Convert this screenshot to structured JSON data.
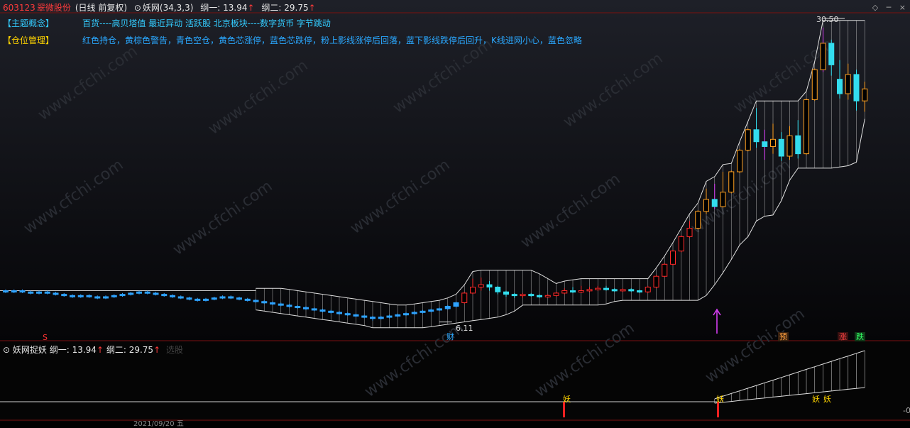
{
  "header": {
    "code": "603123",
    "name": "翠微股份",
    "mode": "(日线 前复权)",
    "indicator": "妖网(34,3,3)",
    "line1_label": "纲一: 13.94",
    "line2_label": "纲二: 29.75",
    "up_arrow": "↑"
  },
  "window_controls": {
    "diamond": "◇",
    "minimize": "─",
    "close": "×"
  },
  "concepts": {
    "theme_label": "【主题概念】",
    "theme_text": "百货----高贝塔值 最近异动 活跃股 北京板块----数字货币 字节跳动",
    "position_label": "【仓位管理】",
    "position_text": "红色持仓，黄棕色警告，青色空仓，黄色芯涨停，蓝色芯跌停，粉上影线涨停后回落，蓝下影线跌停后回升，K线进网小心，蓝色忽略"
  },
  "price_labels": {
    "high": "30.50",
    "low": "6.11"
  },
  "markers": {
    "s": "S",
    "cai": "财",
    "yu": "预",
    "zhang": "涨",
    "die": "跌"
  },
  "sub_panel": {
    "title": "妖网捉妖",
    "line1_label": "纲一: 13.94",
    "line2_label": "纲二: 29.75",
    "up_arrow": "↑",
    "extra": "选股",
    "yao_marks": [
      "妖",
      "妖",
      "妖",
      "妖"
    ]
  },
  "footer": {
    "date_fragment": "2021/09/20 五",
    "right_zero": "-0"
  },
  "watermark": "www.cfchi.com",
  "colors": {
    "up": "#ff2a2a",
    "down": "#2ea3ff",
    "cyan": "#33ddee",
    "yellow": "#ffd400",
    "magenta": "#e040ff",
    "orange": "#ffa020"
  },
  "chart_data": {
    "type": "candlestick",
    "ylim": [
      5.5,
      31.5
    ],
    "candles": [
      {
        "o": 8.6,
        "c": 8.5,
        "h": 8.7,
        "l": 8.4
      },
      {
        "o": 8.5,
        "c": 8.6,
        "h": 8.7,
        "l": 8.4
      },
      {
        "o": 8.6,
        "c": 8.5,
        "h": 8.7,
        "l": 8.4
      },
      {
        "o": 8.5,
        "c": 8.4,
        "h": 8.6,
        "l": 8.3
      },
      {
        "o": 8.4,
        "c": 8.5,
        "h": 8.6,
        "l": 8.3
      },
      {
        "o": 8.5,
        "c": 8.4,
        "h": 8.6,
        "l": 8.3
      },
      {
        "o": 8.4,
        "c": 8.3,
        "h": 8.5,
        "l": 8.2
      },
      {
        "o": 8.3,
        "c": 8.2,
        "h": 8.4,
        "l": 8.1
      },
      {
        "o": 8.2,
        "c": 8.1,
        "h": 8.3,
        "l": 8.0
      },
      {
        "o": 8.1,
        "c": 8.2,
        "h": 8.3,
        "l": 8.0
      },
      {
        "o": 8.2,
        "c": 8.1,
        "h": 8.3,
        "l": 8.0
      },
      {
        "o": 8.1,
        "c": 8.0,
        "h": 8.2,
        "l": 7.9
      },
      {
        "o": 8.0,
        "c": 8.1,
        "h": 8.2,
        "l": 7.9
      },
      {
        "o": 8.1,
        "c": 8.2,
        "h": 8.3,
        "l": 8.0
      },
      {
        "o": 8.2,
        "c": 8.3,
        "h": 8.4,
        "l": 8.1
      },
      {
        "o": 8.3,
        "c": 8.4,
        "h": 8.5,
        "l": 8.2
      },
      {
        "o": 8.4,
        "c": 8.5,
        "h": 8.6,
        "l": 8.3
      },
      {
        "o": 8.5,
        "c": 8.4,
        "h": 8.6,
        "l": 8.3
      },
      {
        "o": 8.4,
        "c": 8.3,
        "h": 8.5,
        "l": 8.2
      },
      {
        "o": 8.3,
        "c": 8.2,
        "h": 8.4,
        "l": 8.1
      },
      {
        "o": 8.2,
        "c": 8.1,
        "h": 8.3,
        "l": 8.0
      },
      {
        "o": 8.1,
        "c": 8.0,
        "h": 8.2,
        "l": 7.9
      },
      {
        "o": 8.0,
        "c": 7.9,
        "h": 8.1,
        "l": 7.8
      },
      {
        "o": 7.9,
        "c": 7.8,
        "h": 8.0,
        "l": 7.7
      },
      {
        "o": 7.8,
        "c": 7.9,
        "h": 8.0,
        "l": 7.7
      },
      {
        "o": 7.9,
        "c": 8.0,
        "h": 8.1,
        "l": 7.8
      },
      {
        "o": 8.0,
        "c": 8.1,
        "h": 8.2,
        "l": 7.9
      },
      {
        "o": 8.1,
        "c": 8.0,
        "h": 8.2,
        "l": 7.9
      },
      {
        "o": 8.0,
        "c": 7.9,
        "h": 8.1,
        "l": 7.8
      },
      {
        "o": 7.9,
        "c": 7.8,
        "h": 8.0,
        "l": 7.7
      },
      {
        "o": 7.8,
        "c": 7.7,
        "h": 7.9,
        "l": 7.6
      },
      {
        "o": 7.7,
        "c": 7.6,
        "h": 7.8,
        "l": 7.5
      },
      {
        "o": 7.6,
        "c": 7.5,
        "h": 7.7,
        "l": 7.4
      },
      {
        "o": 7.5,
        "c": 7.4,
        "h": 7.6,
        "l": 7.3
      },
      {
        "o": 7.4,
        "c": 7.3,
        "h": 7.5,
        "l": 7.2
      },
      {
        "o": 7.3,
        "c": 7.2,
        "h": 7.4,
        "l": 7.1
      },
      {
        "o": 7.2,
        "c": 7.1,
        "h": 7.3,
        "l": 7.0
      },
      {
        "o": 7.1,
        "c": 7.0,
        "h": 7.2,
        "l": 6.9
      },
      {
        "o": 7.0,
        "c": 6.9,
        "h": 7.1,
        "l": 6.8
      },
      {
        "o": 6.9,
        "c": 6.8,
        "h": 7.0,
        "l": 6.7
      },
      {
        "o": 6.8,
        "c": 6.7,
        "h": 6.9,
        "l": 6.6
      },
      {
        "o": 6.7,
        "c": 6.6,
        "h": 6.8,
        "l": 6.5
      },
      {
        "o": 6.6,
        "c": 6.5,
        "h": 6.7,
        "l": 6.4
      },
      {
        "o": 6.5,
        "c": 6.4,
        "h": 6.6,
        "l": 6.3
      },
      {
        "o": 6.4,
        "c": 6.3,
        "h": 6.5,
        "l": 6.11
      },
      {
        "o": 6.3,
        "c": 6.4,
        "h": 6.5,
        "l": 6.2
      },
      {
        "o": 6.4,
        "c": 6.5,
        "h": 6.6,
        "l": 6.3
      },
      {
        "o": 6.5,
        "c": 6.6,
        "h": 6.7,
        "l": 6.4
      },
      {
        "o": 6.6,
        "c": 6.7,
        "h": 6.8,
        "l": 6.5
      },
      {
        "o": 6.7,
        "c": 6.8,
        "h": 6.9,
        "l": 6.6
      },
      {
        "o": 6.8,
        "c": 6.9,
        "h": 7.0,
        "l": 6.7
      },
      {
        "o": 6.9,
        "c": 7.0,
        "h": 7.1,
        "l": 6.8
      },
      {
        "o": 7.0,
        "c": 7.1,
        "h": 7.2,
        "l": 6.9
      },
      {
        "o": 7.1,
        "c": 7.3,
        "h": 7.4,
        "l": 7.0
      },
      {
        "o": 7.3,
        "c": 7.6,
        "h": 7.7,
        "l": 7.2
      },
      {
        "o": 7.6,
        "c": 8.4,
        "h": 8.5,
        "l": 7.5
      },
      {
        "o": 8.4,
        "c": 8.9,
        "h": 9.6,
        "l": 8.3
      },
      {
        "o": 8.9,
        "c": 9.1,
        "h": 9.7,
        "l": 8.6
      },
      {
        "o": 9.1,
        "c": 8.9,
        "h": 9.4,
        "l": 8.6
      },
      {
        "o": 8.9,
        "c": 8.5,
        "h": 9.0,
        "l": 8.3
      },
      {
        "o": 8.5,
        "c": 8.3,
        "h": 8.6,
        "l": 8.1
      },
      {
        "o": 8.3,
        "c": 8.2,
        "h": 8.4,
        "l": 8.0
      },
      {
        "o": 8.2,
        "c": 8.3,
        "h": 8.4,
        "l": 8.0
      },
      {
        "o": 8.3,
        "c": 8.2,
        "h": 8.4,
        "l": 8.1
      },
      {
        "o": 8.2,
        "c": 8.1,
        "h": 8.3,
        "l": 8.0
      },
      {
        "o": 8.1,
        "c": 8.2,
        "h": 8.3,
        "l": 8.0
      },
      {
        "o": 8.2,
        "c": 8.4,
        "h": 8.5,
        "l": 8.1
      },
      {
        "o": 8.4,
        "c": 8.6,
        "h": 8.8,
        "l": 8.3
      },
      {
        "o": 8.6,
        "c": 8.5,
        "h": 8.9,
        "l": 8.4
      },
      {
        "o": 8.5,
        "c": 8.6,
        "h": 9.0,
        "l": 8.4
      },
      {
        "o": 8.6,
        "c": 8.7,
        "h": 8.9,
        "l": 8.5
      },
      {
        "o": 8.7,
        "c": 8.8,
        "h": 9.0,
        "l": 8.6
      },
      {
        "o": 8.8,
        "c": 8.7,
        "h": 9.0,
        "l": 8.6
      },
      {
        "o": 8.7,
        "c": 8.6,
        "h": 8.8,
        "l": 8.5
      },
      {
        "o": 8.6,
        "c": 8.7,
        "h": 8.8,
        "l": 8.5
      },
      {
        "o": 8.7,
        "c": 8.6,
        "h": 8.8,
        "l": 8.5
      },
      {
        "o": 8.6,
        "c": 8.5,
        "h": 8.7,
        "l": 8.4
      },
      {
        "o": 8.5,
        "c": 8.9,
        "h": 9.0,
        "l": 8.4
      },
      {
        "o": 8.9,
        "c": 9.8,
        "h": 9.9,
        "l": 8.8
      },
      {
        "o": 9.8,
        "c": 10.8,
        "h": 10.9,
        "l": 9.7
      },
      {
        "o": 10.8,
        "c": 11.9,
        "h": 12.0,
        "l": 10.7
      },
      {
        "o": 11.9,
        "c": 13.1,
        "h": 13.2,
        "l": 11.8
      },
      {
        "o": 13.1,
        "c": 13.8,
        "h": 14.4,
        "l": 13.0
      },
      {
        "o": 13.8,
        "c": 15.2,
        "h": 15.3,
        "l": 13.7
      },
      {
        "o": 15.2,
        "c": 16.2,
        "h": 17.1,
        "l": 15.0
      },
      {
        "o": 16.2,
        "c": 15.6,
        "h": 17.5,
        "l": 15.4
      },
      {
        "o": 15.6,
        "c": 16.8,
        "h": 18.5,
        "l": 15.5
      },
      {
        "o": 16.8,
        "c": 18.5,
        "h": 18.6,
        "l": 16.7
      },
      {
        "o": 18.5,
        "c": 20.3,
        "h": 20.4,
        "l": 18.4
      },
      {
        "o": 20.3,
        "c": 22.0,
        "h": 22.1,
        "l": 20.2
      },
      {
        "o": 22.0,
        "c": 21.0,
        "h": 23.8,
        "l": 20.5
      },
      {
        "o": 21.0,
        "c": 20.6,
        "h": 22.0,
        "l": 19.5
      },
      {
        "o": 20.6,
        "c": 21.2,
        "h": 22.5,
        "l": 20.0
      },
      {
        "o": 21.2,
        "c": 19.8,
        "h": 21.8,
        "l": 19.4
      },
      {
        "o": 19.8,
        "c": 21.5,
        "h": 22.3,
        "l": 19.5
      },
      {
        "o": 21.5,
        "c": 20.0,
        "h": 22.8,
        "l": 19.6
      },
      {
        "o": 20.0,
        "c": 24.5,
        "h": 24.6,
        "l": 19.9
      },
      {
        "o": 24.5,
        "c": 27.0,
        "h": 27.1,
        "l": 24.4
      },
      {
        "o": 27.0,
        "c": 29.2,
        "h": 30.5,
        "l": 26.8
      },
      {
        "o": 29.2,
        "c": 27.4,
        "h": 29.5,
        "l": 26.5
      },
      {
        "o": 26.2,
        "c": 25.0,
        "h": 27.8,
        "l": 24.6
      },
      {
        "o": 25.0,
        "c": 26.6,
        "h": 27.5,
        "l": 24.5
      },
      {
        "o": 26.6,
        "c": 24.4,
        "h": 27.0,
        "l": 23.6
      },
      {
        "o": 24.4,
        "c": 25.4,
        "h": 26.0,
        "l": 23.5
      }
    ],
    "line1_value": 13.94,
    "line2_value": 29.75
  }
}
